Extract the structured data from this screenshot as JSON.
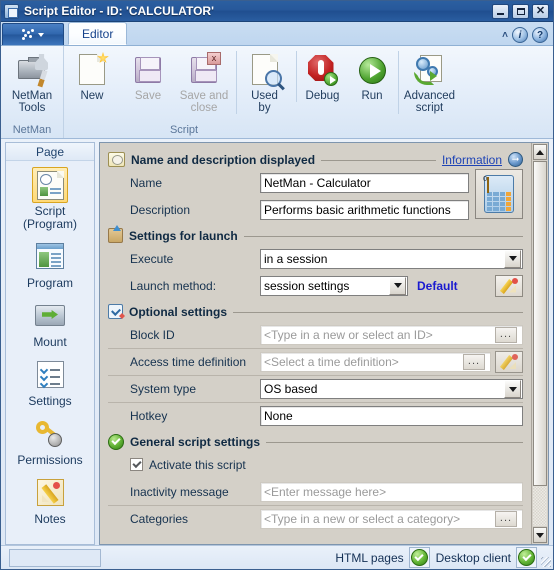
{
  "window": {
    "title": "Script Editor - ID: 'CALCULATOR'",
    "icon": "script-editor-icon",
    "minimize_label": "",
    "maximize_label": "",
    "close_label": "✕"
  },
  "ribbon": {
    "app_button_label": "",
    "tabs": [
      {
        "label": "Editor",
        "active": true
      }
    ],
    "collapse_label": "˄",
    "info_label": "i",
    "help_label": "?",
    "groups": [
      {
        "label": "NetMan",
        "buttons": [
          {
            "label": "NetMan\nTools",
            "label_line1": "NetMan",
            "label_line2": "Tools",
            "icon": "netman-tools-icon",
            "enabled": true
          }
        ]
      },
      {
        "label": "Script",
        "buttons": [
          {
            "label_line1": "New",
            "label_line2": "",
            "icon": "new-document-icon",
            "enabled": true
          },
          {
            "label_line1": "Save",
            "label_line2": "",
            "icon": "save-icon",
            "enabled": false
          },
          {
            "label_line1": "Save and",
            "label_line2": "close",
            "icon": "save-and-close-icon",
            "enabled": false
          },
          {
            "label_line1": "Used",
            "label_line2": "by",
            "icon": "used-by-icon",
            "enabled": true
          },
          {
            "label_line1": "Debug",
            "label_line2": "",
            "icon": "debug-icon",
            "enabled": true
          },
          {
            "label_line1": "Run",
            "label_line2": "",
            "icon": "run-icon",
            "enabled": true
          },
          {
            "label_line1": "Advanced",
            "label_line2": "script",
            "icon": "advanced-script-icon",
            "enabled": true
          }
        ]
      }
    ]
  },
  "sidebar": {
    "header": "Page",
    "items": [
      {
        "label_line1": "Script",
        "label_line2": "(Program)",
        "icon": "script-program-icon",
        "selected": true
      },
      {
        "label_line1": "Program",
        "label_line2": "",
        "icon": "program-icon",
        "selected": false
      },
      {
        "label_line1": "Mount",
        "label_line2": "",
        "icon": "mount-icon",
        "selected": false
      },
      {
        "label_line1": "Settings",
        "label_line2": "",
        "icon": "settings-icon",
        "selected": false
      },
      {
        "label_line1": "Permissions",
        "label_line2": "",
        "icon": "permissions-key-icon",
        "selected": false
      },
      {
        "label_line1": "Notes",
        "label_line2": "",
        "icon": "notes-pencil-icon",
        "selected": false
      }
    ]
  },
  "form": {
    "sections": [
      {
        "id": "name-and-description",
        "title": "Name and description displayed",
        "icon": "name-description-icon",
        "link": "Information",
        "badge_icon": "collapse-arrow-icon"
      },
      {
        "id": "settings-for-launch",
        "title": "Settings for launch",
        "icon": "launch-box-icon"
      },
      {
        "id": "optional-settings",
        "title": "Optional settings",
        "icon": "optional-settings-icon"
      },
      {
        "id": "general-script-settings",
        "title": "General script settings",
        "icon": "green-check-icon"
      }
    ],
    "name": {
      "label": "Name",
      "value": "NetMan - Calculator",
      "placeholder": ""
    },
    "description": {
      "label": "Description",
      "value": "Performs basic arithmetic functions",
      "placeholder": ""
    },
    "app_icon_button": {
      "name": "calculator-icon-button",
      "icon": "calculator-icon"
    },
    "execute": {
      "label": "Execute",
      "value": "in a session"
    },
    "launch_method": {
      "label": "Launch method:",
      "value": "session settings",
      "default_label": "Default",
      "edit_icon": "pencil-edit-icon"
    },
    "block_id": {
      "label": "Block ID",
      "value": "",
      "placeholder": "<Type in a new or select an ID>",
      "browse_label": "..."
    },
    "access_time": {
      "label": "Access time definition",
      "value": "",
      "placeholder": "<Select a time definition>",
      "browse_label": "...",
      "edit_icon": "pencil-edit-icon"
    },
    "system_type": {
      "label": "System type",
      "value": "OS based"
    },
    "hotkey": {
      "label": "Hotkey",
      "value": "None"
    },
    "activate": {
      "label": "Activate this script",
      "checked": true
    },
    "inactivity_message": {
      "label": "Inactivity message",
      "value": "",
      "placeholder": "<Enter message here>"
    },
    "categories": {
      "label": "Categories",
      "value": "",
      "placeholder": "<Type in a new or select a category>",
      "browse_label": "..."
    }
  },
  "statusbar": {
    "items": [
      {
        "label": "HTML pages",
        "status": "ok",
        "icon": "green-check-icon"
      },
      {
        "label": "Desktop client",
        "status": "ok",
        "icon": "green-check-icon"
      }
    ]
  },
  "colors": {
    "titlebar": "#27589a",
    "accent_link": "#1e43b5",
    "default_text": "#1a1ad0",
    "ok_green": "#5fb033",
    "selection_gold": "#ffd976",
    "form_bg": "#d4d0c8"
  }
}
